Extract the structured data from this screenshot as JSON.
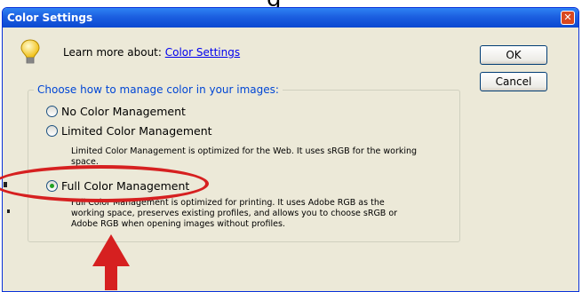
{
  "page": {
    "heading_fragment": "g"
  },
  "dialog": {
    "title": "Color Settings",
    "close_glyph": "✕",
    "learn_more": {
      "label": "Learn more about: ",
      "link": "Color Settings",
      "icon": "lightbulb-icon"
    },
    "buttons": {
      "ok": "OK",
      "cancel": "Cancel"
    },
    "group": {
      "legend": "Choose how to manage color in your images:",
      "options": [
        {
          "label": "No Color Management",
          "checked": false
        },
        {
          "label": "Limited Color Management",
          "checked": false,
          "description": "Limited Color Management is optimized for the Web. It uses sRGB for the working space."
        },
        {
          "label": "Full Color Management",
          "checked": true,
          "description_lines": [
            "Full Color Management is optimized for printing. It uses Adobe RGB as the",
            "working space, preserves existing profiles, and allows you to choose sRGB or",
            "Adobe RGB when opening images without profiles."
          ]
        }
      ]
    }
  },
  "colors": {
    "titlebar": "#0a48d1",
    "dialog_bg": "#ece9d8",
    "legend_text": "#0046d5",
    "annotation": "#d62020",
    "radio_checked": "#21a121"
  }
}
